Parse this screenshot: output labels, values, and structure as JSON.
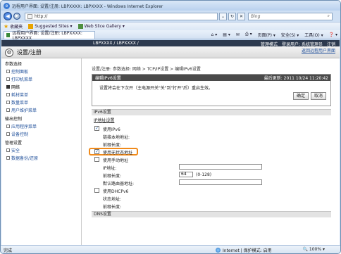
{
  "window": {
    "title": "远程用户界面: 设置/注册: LBPXXXX: LBPXXXX - Windows Internet Explorer"
  },
  "address": {
    "value": "http://",
    "search_placeholder": "Bing"
  },
  "favorites": {
    "label": "收藏夹",
    "items": [
      "Suggested Sites ▾",
      "Web Slice Gallery ▾"
    ]
  },
  "tab": {
    "label": "远程用户界面: 设置/注册: LBPXXXX: LBPXXXX"
  },
  "tools": {
    "page": "页面(P) ▾",
    "safety": "安全(S) ▾",
    "tools": "工具(O) ▾",
    "help": "❓ ▾"
  },
  "header": {
    "model": "LBPXXXX / LBPXXXX /",
    "admin_mode": "管理模式",
    "login_user": "登录用户: 系统管理员",
    "logout": "注销",
    "title": "设置/注册",
    "to_portal": "返回远程用户界面"
  },
  "sidebar": {
    "groups": [
      {
        "label": "参数选择",
        "items": [
          "控制面板",
          "打印机菜单",
          "网络",
          "耗材菜单",
          "数量菜单",
          "用户维护菜单"
        ]
      },
      {
        "label": "输出控制",
        "items": [
          "应用程序菜单",
          "设备控制"
        ]
      },
      {
        "label": "管理设置",
        "items": [
          "安全",
          "数据备份/还原"
        ]
      }
    ],
    "selected": "网络"
  },
  "main": {
    "breadcrumb": "设置/注册: 参数选择: 网络 > TCP/IP设置 > 编辑IPv6设置",
    "panel_title": "编辑IPv6设置",
    "last_updated": "最后更新: 2011 10/24 11:20:42",
    "message": "设置将会在下次开（主电源开关\"关\"到\"打开\"后）重启生效。",
    "ok": "确定",
    "cancel": "取消"
  },
  "ipv6": {
    "section": "IPv6设置",
    "subsection": "IP地址设置",
    "use_ipv6": "使用IPv6",
    "use_ipv6_checked": true,
    "link_local": "链接本地地址:",
    "prefix_len_label": "前缀长度:",
    "use_stateless": "使用无状态地址",
    "use_stateless_checked": true,
    "use_manual": "使用手动地址",
    "use_manual_checked": false,
    "ip_label": "IP地址:",
    "ip_value": "",
    "prefix_label": "前缀长度:",
    "prefix_value": "64",
    "prefix_range": "(0-128)",
    "gateway_label": "默认路由器地址:",
    "gateway_value": "",
    "use_dhcp": "使用DHCPv6",
    "use_dhcp_checked": false,
    "state_addr": "状态地址:",
    "state_prefix": "前缀长度:",
    "dns_section": "DNS设置"
  },
  "status": {
    "done": "完成",
    "zone": "Internet | 保护模式: 启用",
    "zoom": "100%"
  }
}
